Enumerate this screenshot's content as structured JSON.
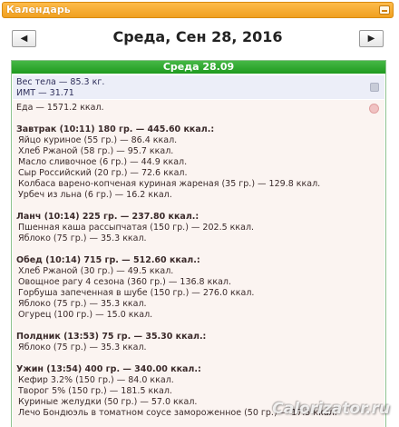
{
  "window": {
    "title": "Календарь"
  },
  "nav": {
    "prev_icon": "◀",
    "next_icon": "▶",
    "date": "Среда, Сен 28, 2016"
  },
  "day": {
    "header": "Среда 28.09"
  },
  "body": {
    "weight": "Вес тела — 85.3 кг.",
    "bmi": "ИМТ — 31.71"
  },
  "food": {
    "total": "Еда — 1571.2 ккал.",
    "meals": [
      {
        "title": "Завтрак (10:11) 180 гр. — 445.60 ккал.:",
        "items": [
          "Яйцо куриное (55 гр.) — 86.4 ккал.",
          "Хлеб Ржаной (58 гр.) — 95.7 ккал.",
          "Масло сливочное (6 гр.) — 44.9 ккал.",
          "Сыр Российский (20 гр.) — 72.6 ккал.",
          "Колбаса варено-копченая куриная жареная (35 гр.) — 129.8 ккал.",
          "Урбеч из льна (6 гр.) — 16.2 ккал."
        ]
      },
      {
        "title": "Ланч (10:14) 225 гр. — 237.80 ккал.:",
        "items": [
          "Пшенная каша рассыпчатая (150 гр.) — 202.5 ккал.",
          "Яблоко (75 гр.) — 35.3 ккал."
        ]
      },
      {
        "title": "Обед (10:14) 715 гр. — 512.60 ккал.:",
        "items": [
          "Хлеб Ржаной (30 гр.) — 49.5 ккал.",
          "Овощное рагу 4 сезона (360 гр.) — 136.8 ккал.",
          "Горбуша запеченная в шубе (150 гр.) — 276.0 ккал.",
          "Яблоко (75 гр.) — 35.3 ккал.",
          "Огурец (100 гр.) — 15.0 ккал."
        ]
      },
      {
        "title": "Полдник (13:53) 75 гр. — 35.30 ккал.:",
        "items": [
          "Яблоко (75 гр.) — 35.3 ккал."
        ]
      },
      {
        "title": "Ужин (13:54) 400 гр. — 340.00 ккал.:",
        "items": [
          "Кефир 3.2% (150 гр.) — 84.0 ккал.",
          "Творог 5% (150 гр.) — 181.5 ккал.",
          "Куриные желудки (50 гр.) — 57.0 ккал.",
          "Лечо Бондюэль в томатном соусе замороженное (50 гр.) — 17.5 ккал."
        ]
      }
    ]
  },
  "watermark": "Calorizator.ru",
  "colors": {
    "titlebar": "#f0a020",
    "day_header": "#1f9a1f",
    "weight_bg": "#eceef8",
    "food_bg": "#fbf4f1"
  }
}
